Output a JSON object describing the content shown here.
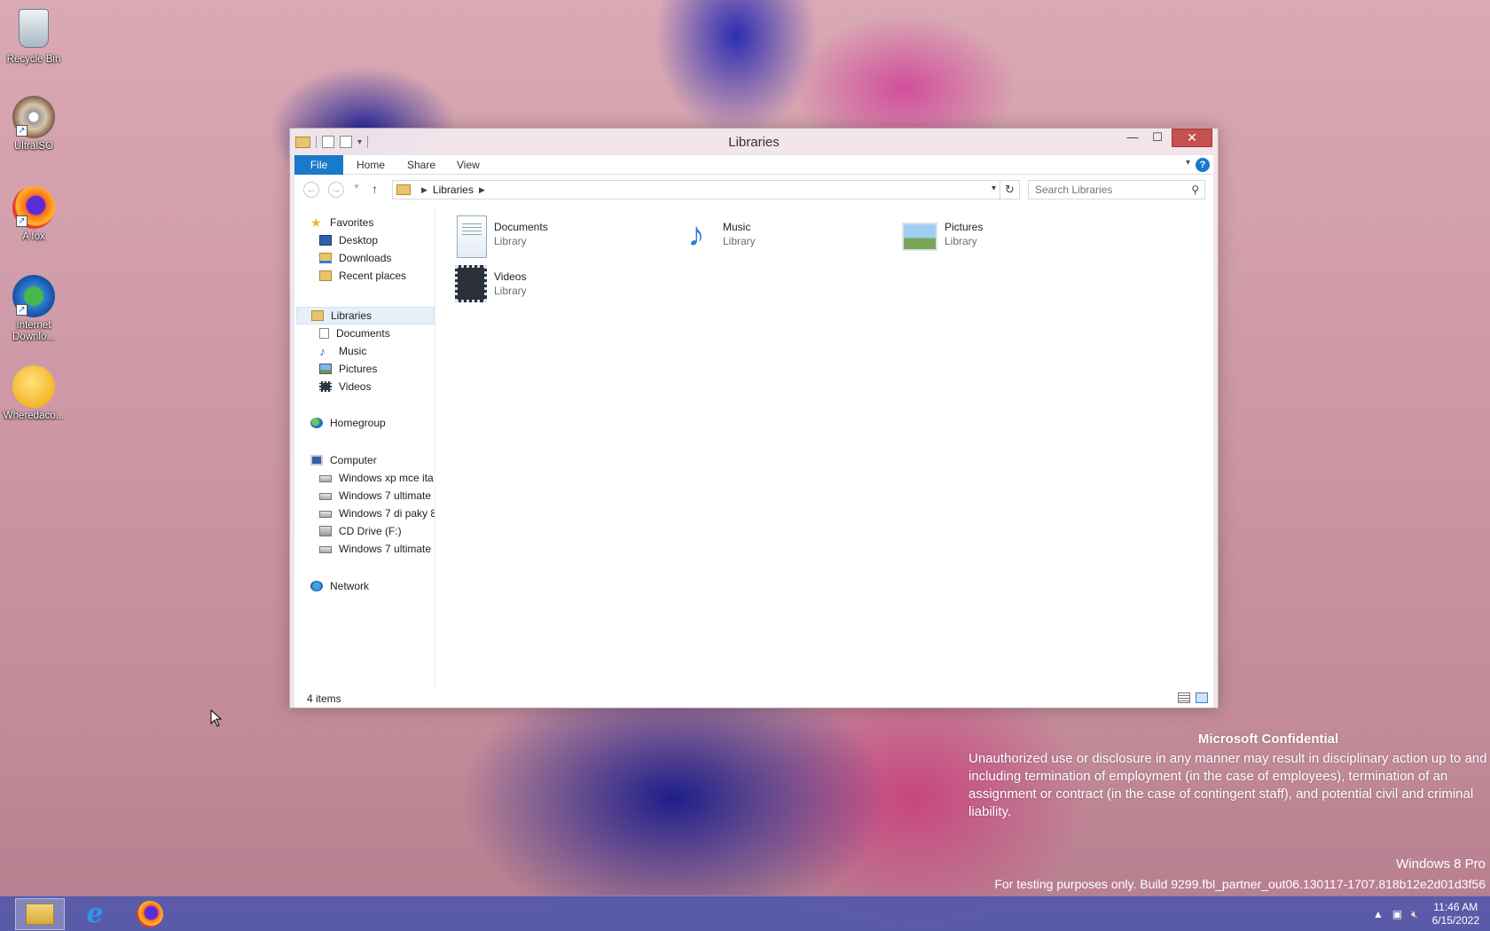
{
  "desktop": {
    "icons": [
      {
        "label": "Recycle Bin",
        "icon": "recycle-bin-icon"
      },
      {
        "label": "UltraISO",
        "icon": "disc-icon"
      },
      {
        "label": "A fox",
        "icon": "firefox-icon"
      },
      {
        "label": "Internet Downlo...",
        "icon": "idm-icon"
      },
      {
        "label": "Wheredaco...",
        "icon": "emoji-icon"
      }
    ]
  },
  "window": {
    "title": "Libraries",
    "controls": {
      "minimize": "—",
      "maximize": "☐",
      "close": "✕"
    },
    "ribbon": {
      "tabs": [
        "File",
        "Home",
        "Share",
        "View"
      ],
      "help": "?"
    },
    "address": {
      "crumbs": [
        "Libraries"
      ],
      "search_placeholder": "Search Libraries"
    },
    "nav": {
      "favorites": {
        "label": "Favorites",
        "items": [
          "Desktop",
          "Downloads",
          "Recent places"
        ]
      },
      "libraries": {
        "label": "Libraries",
        "items": [
          "Documents",
          "Music",
          "Pictures",
          "Videos"
        ]
      },
      "homegroup": {
        "label": "Homegroup"
      },
      "computer": {
        "label": "Computer",
        "items": [
          "Windows xp mce ita",
          "Windows 7 ultimate",
          "Windows 7 di paky 8",
          "CD Drive (F:)",
          "Windows 7 ultimate"
        ]
      },
      "network": {
        "label": "Network"
      }
    },
    "libraries": [
      {
        "name": "Documents",
        "type": "Library"
      },
      {
        "name": "Music",
        "type": "Library"
      },
      {
        "name": "Pictures",
        "type": "Library"
      },
      {
        "name": "Videos",
        "type": "Library"
      }
    ],
    "status": "4 items"
  },
  "watermark": {
    "heading": "Microsoft Confidential",
    "text": "Unauthorized use or disclosure in any manner may result in disciplinary action up to and including termination of employment (in the case of employees), termination of an assignment or contract (in the case of contingent staff), and potential civil and criminal liability.",
    "edition": "Windows 8 Pro",
    "build": "For testing purposes only. Build 9299.fbl_partner_out06.130117-1707.818b12e2d01d3f56"
  },
  "taskbar": {
    "clock_time": "11:46 AM",
    "clock_date": "6/15/2022"
  }
}
